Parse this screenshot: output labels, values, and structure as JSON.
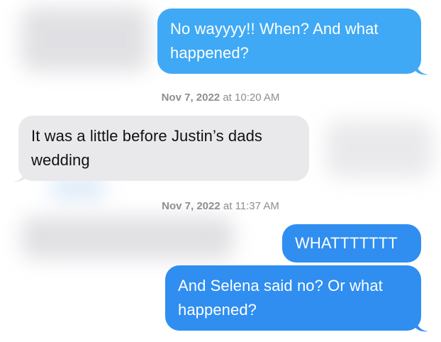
{
  "colors": {
    "sent_bubble": "#3fa9f5",
    "sent_bubble_alt": "#2f8ef0",
    "received_bubble": "#e9e9eb",
    "timestamp_text": "#8e8e93"
  },
  "messages": [
    {
      "direction": "sent",
      "text": "No wayyyy!! When? And what happened?"
    },
    {
      "direction": "received",
      "text": "It was a little before Justin’s dads wedding"
    },
    {
      "direction": "sent",
      "text": "WHATTTTTTT"
    },
    {
      "direction": "sent",
      "text": "And Selena said no? Or what happened?"
    }
  ],
  "timestamps": [
    {
      "date": "Nov 7, 2022",
      "time": "at 10:20 AM"
    },
    {
      "date": "Nov 7, 2022",
      "time": "at 11:37 AM"
    }
  ]
}
